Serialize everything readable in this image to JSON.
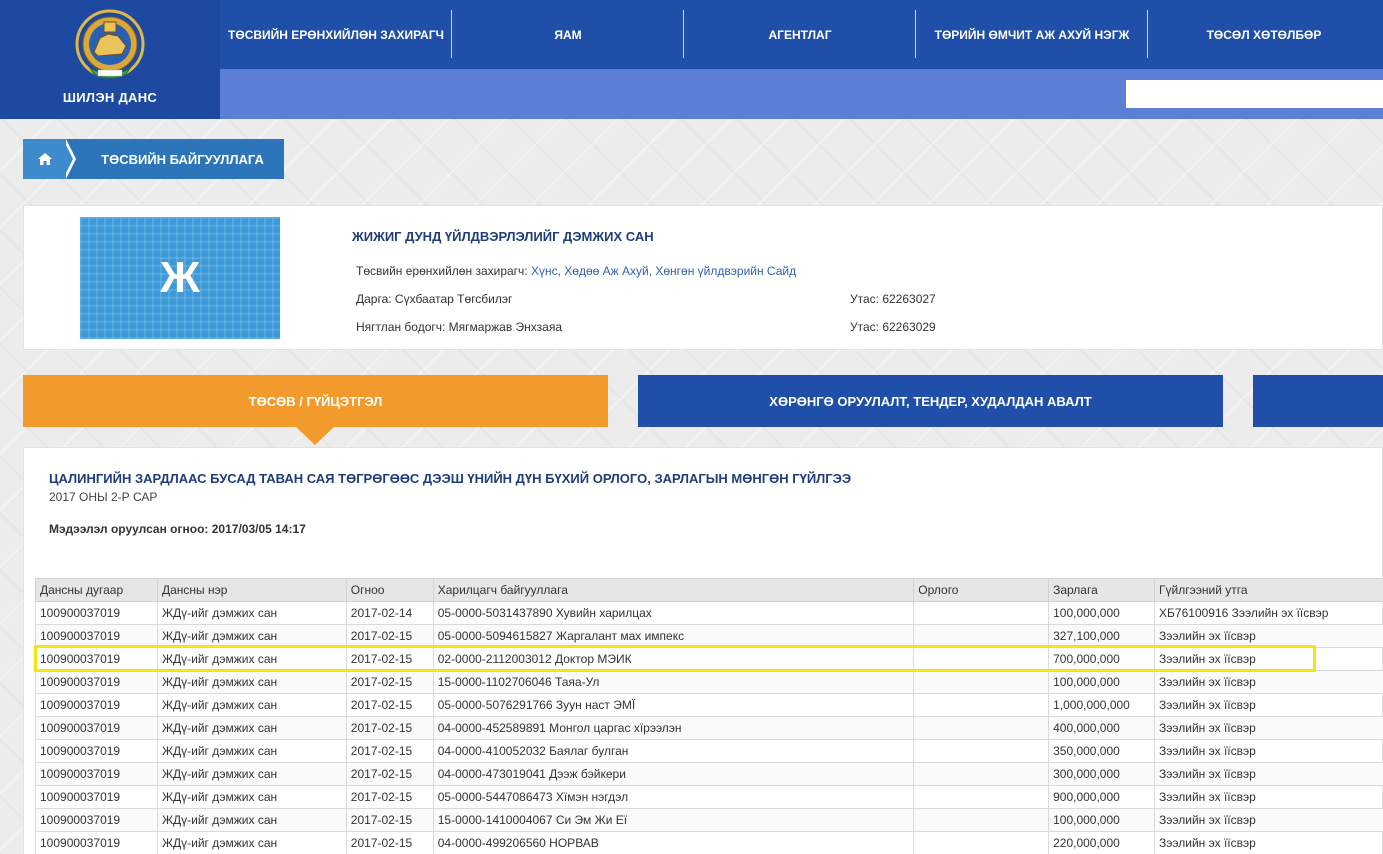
{
  "header": {
    "logo_text": "ШИЛЭН ДАНС",
    "nav": [
      {
        "label": "ТӨСВИЙН ЕРӨНХИЙЛӨН ЗАХИРАГЧ"
      },
      {
        "label": "ЯАМ"
      },
      {
        "label": "АГЕНТЛАГ"
      },
      {
        "label": "ТӨРИЙН ӨМЧИТ АЖ АХУЙ НЭГЖ"
      },
      {
        "label": "ТӨСӨЛ ХӨТӨЛБӨР"
      }
    ],
    "search_value": ""
  },
  "breadcrumb": {
    "home_icon": "home-icon",
    "label": "ТӨСВИЙН БАЙГУУЛЛАГА"
  },
  "organization": {
    "logo_letter": "Ж",
    "title": "ЖИЖИГ ДУНД ҮЙЛДВЭРЛЭЛИЙГ ДЭМЖИХ САН",
    "manager_label": "Төсвийн ерөнхийлөн захирагч: ",
    "manager_value": "Хүнс, Хөдөө Аж Ахуй, Хөнгөн үйлдвэрийн Сайд",
    "director": "Дарга: Сүхбаатар Төгсбилэг",
    "director_phone": "Утас: 62263027",
    "accountant": "Нягтлан бодогч: Мягмаржав Энхзаяа",
    "accountant_phone": "Утас: 62263029"
  },
  "tabs": [
    {
      "label": "ТӨСӨВ / ГҮЙЦЭТГЭЛ"
    },
    {
      "label": "ХӨРӨНГӨ ОРУУЛАЛТ, ТЕНДЕР, ХУДАЛДАН АВАЛТ"
    },
    {
      "label": ""
    }
  ],
  "report": {
    "title": "ЦАЛИНГИЙН ЗАРДЛААС БУСАД ТАВАН САЯ ТӨГРӨГӨӨС ДЭЭШ ҮНИЙН ДҮН БҮХИЙ ОРЛОГО, ЗАРЛАГЫН МӨНГӨН ГҮЙЛГЭЭ",
    "subtitle": "2017 ОНЫ 2-Р САР",
    "entered": "Мэдээлэл оруулсан огноо: 2017/03/05 14:17",
    "columns": [
      "Дансны дугаар",
      "Дансны нэр",
      "Огноо",
      "Харилцагч байгууллага",
      "Орлого",
      "Зарлага",
      "Гүйлгээний утга"
    ],
    "rows": [
      [
        "100900037019",
        "ЖДү-ийг дэмжих сан",
        "2017-02-14",
        "05-0000-5031437890 Хувийн харилцах",
        "",
        "100,000,000",
        "ХБ76100916 Зээлийн эх їїсвэр"
      ],
      [
        "100900037019",
        "ЖДү-ийг дэмжих сан",
        "2017-02-15",
        "05-0000-5094615827 Жаргалант мах импекс",
        "",
        "327,100,000",
        "Зээлийн эх їїсвэр"
      ],
      [
        "100900037019",
        "ЖДү-ийг дэмжих сан",
        "2017-02-15",
        "02-0000-2112003012 Доктор МЭИК",
        "",
        "700,000,000",
        "Зээлийн эх їїсвэр"
      ],
      [
        "100900037019",
        "ЖДү-ийг дэмжих сан",
        "2017-02-15",
        "15-0000-1102706046 Таяа-Ул",
        "",
        "100,000,000",
        "Зээлийн эх їїсвэр"
      ],
      [
        "100900037019",
        "ЖДү-ийг дэмжих сан",
        "2017-02-15",
        "05-0000-5076291766 Зуун наст ЭМЇ",
        "",
        "1,000,000,000",
        "Зээлийн эх їїсвэр"
      ],
      [
        "100900037019",
        "ЖДү-ийг дэмжих сан",
        "2017-02-15",
        "04-0000-452589891 Монгол царгас хїрээлэн",
        "",
        "400,000,000",
        "Зээлийн эх їїсвэр"
      ],
      [
        "100900037019",
        "ЖДү-ийг дэмжих сан",
        "2017-02-15",
        "04-0000-410052032 Баялаг булган",
        "",
        "350,000,000",
        "Зээлийн эх їїсвэр"
      ],
      [
        "100900037019",
        "ЖДү-ийг дэмжих сан",
        "2017-02-15",
        "04-0000-473019041 Дээж бэйкери",
        "",
        "300,000,000",
        "Зээлийн эх їїсвэр"
      ],
      [
        "100900037019",
        "ЖДү-ийг дэмжих сан",
        "2017-02-15",
        "05-0000-5447086473 Хїмэн нэгдэл",
        "",
        "900,000,000",
        "Зээлийн эх їїсвэр"
      ],
      [
        "100900037019",
        "ЖДү-ийг дэмжих сан",
        "2017-02-15",
        "15-0000-1410004067 Си Эм Жи Еї",
        "",
        "100,000,000",
        "Зээлийн эх їїсвэр"
      ],
      [
        "100900037019",
        "ЖДү-ийг дэмжих сан",
        "2017-02-15",
        "04-0000-499206560 НОРВАВ",
        "",
        "220,000,000",
        "Зээлийн эх їїсвэр"
      ]
    ],
    "highlighted_row": 2,
    "highlight_color": "#f5e50a"
  },
  "colors": {
    "nav_blue": "#1f4fa8",
    "subbar_blue": "#5b7fd4",
    "tab_orange": "#f39a2c",
    "breadcrumb_blue": "#2d75bb",
    "title_navy": "#1f3d7a"
  }
}
